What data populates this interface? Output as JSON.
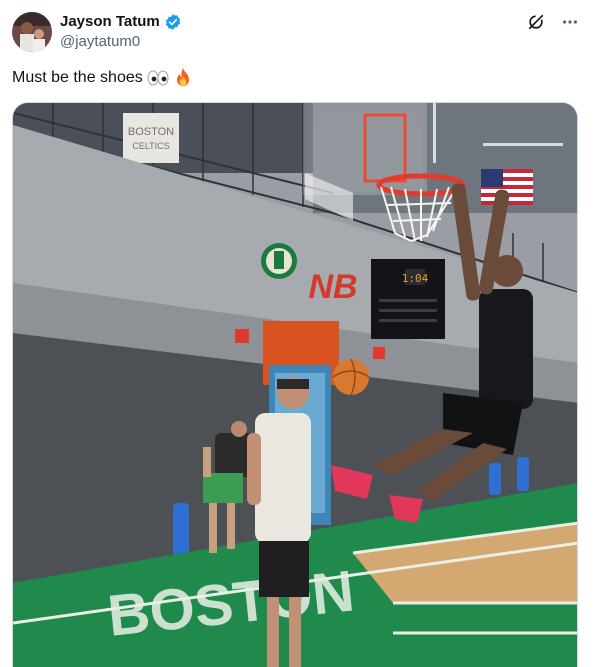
{
  "author": {
    "display_name": "Jayson Tatum",
    "handle": "@jaytatum0",
    "verified": true,
    "avatar_icon": "avatar-photo"
  },
  "actions": {
    "grok_icon": "grok-icon",
    "more_icon": "more-icon"
  },
  "tweet": {
    "text": "Must be the shoes",
    "emojis": [
      "eyes-emoji",
      "fire-emoji"
    ]
  },
  "media": {
    "type": "video",
    "description_icon": "basketball-dunk-video",
    "wall_text": "BOSTON CELTICS",
    "floor_text": "BOSTON",
    "scoreboard": "1:04"
  },
  "colors": {
    "verified_blue": "#1d9bf0",
    "secondary_text": "#536471",
    "court_green": "#1f8a4c",
    "rim_red": "#d33a2a"
  }
}
